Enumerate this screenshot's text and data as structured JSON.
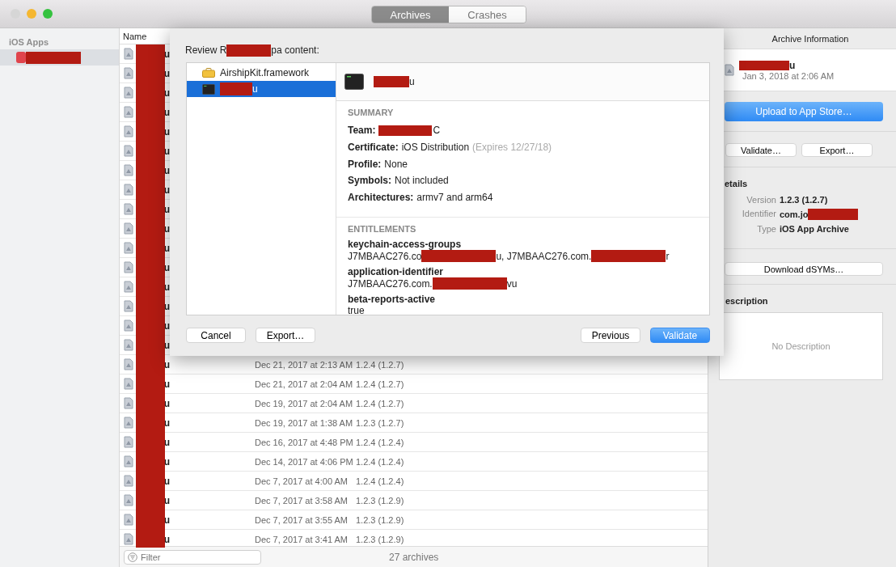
{
  "window": {
    "traffic_lights": [
      {
        "color": "#d6d6d6"
      },
      {
        "color": "#f5b731"
      },
      {
        "color": "#35c23f"
      }
    ],
    "segments": [
      {
        "label": "Archives",
        "selected": true
      },
      {
        "label": "Crashes",
        "selected": false
      }
    ]
  },
  "sidebar": {
    "header": "iOS Apps",
    "items": [
      {
        "selected": true,
        "parts": [
          {
            "kind": "redaction"
          }
        ]
      }
    ]
  },
  "table": {
    "columns": [
      "Name"
    ],
    "name_redacted": true,
    "rows": [
      {
        "name": "u"
      },
      {
        "name": "u"
      },
      {
        "name": "u"
      },
      {
        "name": "u"
      },
      {
        "name": "u"
      },
      {
        "name": "u"
      },
      {
        "name": "u"
      },
      {
        "name": "u"
      },
      {
        "name": "u"
      },
      {
        "name": "u"
      },
      {
        "name": "u"
      },
      {
        "name": "u"
      },
      {
        "name": "u"
      },
      {
        "name": "u"
      },
      {
        "name": "u"
      },
      {
        "name": "u"
      },
      {
        "name": "u",
        "date": "Dec 21, 2017 at 2:13 AM",
        "version": "1.2.4 (1.2.7)"
      },
      {
        "name": "u",
        "date": "Dec 21, 2017 at 2:04 AM",
        "version": "1.2.4 (1.2.7)"
      },
      {
        "name": "u",
        "date": "Dec 19, 2017 at 2:04 AM",
        "version": "1.2.4 (1.2.7)"
      },
      {
        "name": "u",
        "date": "Dec 19, 2017 at 1:38 AM",
        "version": "1.2.3 (1.2.7)"
      },
      {
        "name": "u",
        "date": "Dec 16, 2017 at 4:48 PM",
        "version": "1.2.4 (1.2.4)"
      },
      {
        "name": "u",
        "date": "Dec 14, 2017 at 4:06 PM",
        "version": "1.2.4 (1.2.4)"
      },
      {
        "name": "u",
        "date": "Dec 7, 2017 at 4:00 AM",
        "version": "1.2.4 (1.2.4)"
      },
      {
        "name": "u",
        "date": "Dec 7, 2017 at 3:58 AM",
        "version": "1.2.3 (1.2.9)"
      },
      {
        "name": "u",
        "date": "Dec 7, 2017 at 3:55 AM",
        "version": "1.2.3 (1.2.9)"
      },
      {
        "name": "u",
        "date": "Dec 7, 2017 at 3:41 AM",
        "version": "1.2.3 (1.2.9)"
      }
    ],
    "filter": {
      "placeholder": "Filter"
    },
    "count": "27 archives"
  },
  "sheet": {
    "title_parts": [
      {
        "kind": "text",
        "text": "Review R"
      },
      {
        "kind": "redaction"
      },
      {
        "kind": "text",
        "text": "pa content:"
      }
    ],
    "items": [
      {
        "kind": "framework",
        "selected": false,
        "parts": [
          {
            "kind": "text",
            "text": "AirshipKit.framework"
          }
        ]
      },
      {
        "kind": "app",
        "selected": true,
        "parts": [
          {
            "kind": "redaction"
          },
          {
            "kind": "text",
            "text": "u"
          }
        ]
      }
    ],
    "detail": {
      "parts": [
        {
          "kind": "redaction"
        },
        {
          "kind": "text",
          "text": "u"
        }
      ],
      "sections": [
        {
          "heading": "SUMMARY",
          "kind": "inline",
          "fields": [
            {
              "label": "Team:",
              "parts": [
                {
                  "kind": "redaction"
                },
                {
                  "kind": "text",
                  "text": "C"
                }
              ]
            },
            {
              "label": "Certificate:",
              "parts": [
                {
                  "kind": "text",
                  "text": "iOS Distribution"
                }
              ],
              "note": "(Expires 12/27/18)"
            },
            {
              "label": "Profile:",
              "parts": [
                {
                  "kind": "text",
                  "text": "None"
                }
              ]
            },
            {
              "label": "Symbols:",
              "parts": [
                {
                  "kind": "text",
                  "text": "Not included"
                }
              ]
            },
            {
              "label": "Architectures:",
              "parts": [
                {
                  "kind": "text",
                  "text": "armv7 and arm64"
                }
              ]
            }
          ]
        },
        {
          "heading": "ENTITLEMENTS",
          "kind": "stacked",
          "fields": [
            {
              "label": "keychain-access-groups",
              "parts": [
                {
                  "kind": "text",
                  "text": "J7MBAAC276.co"
                },
                {
                  "kind": "redaction"
                },
                {
                  "kind": "text",
                  "text": "u, J7MBAAC276.com."
                },
                {
                  "kind": "redaction"
                },
                {
                  "kind": "text",
                  "text": "r"
                }
              ]
            },
            {
              "label": "application-identifier",
              "parts": [
                {
                  "kind": "text",
                  "text": "J7MBAAC276.com."
                },
                {
                  "kind": "redaction"
                },
                {
                  "kind": "text",
                  "text": "vu"
                }
              ]
            },
            {
              "label": "beta-reports-active",
              "parts": [
                {
                  "kind": "text",
                  "text": "true"
                }
              ]
            }
          ]
        }
      ]
    },
    "left_buttons": [
      {
        "label": "Cancel",
        "primary": false
      },
      {
        "label": "Export…",
        "primary": false
      }
    ],
    "right_buttons": [
      {
        "label": "Previous",
        "primary": false
      },
      {
        "label": "Validate",
        "primary": true
      }
    ]
  },
  "inspector": {
    "title": "Archive Information",
    "archive": {
      "name_parts": [
        {
          "kind": "redaction"
        },
        {
          "kind": "text",
          "text": "u"
        }
      ],
      "date": "Jan 3, 2018 at 2:06 AM"
    },
    "upload_button": "Upload to App Store…",
    "buttons": [
      "Validate…",
      "Export…"
    ],
    "details_heading": "etails",
    "details": [
      {
        "label": "Version",
        "parts": [
          {
            "kind": "text",
            "text": "1.2.3 (1.2.7)"
          }
        ]
      },
      {
        "label": "Identifier",
        "parts": [
          {
            "kind": "text",
            "text": "com.jo"
          },
          {
            "kind": "redaction"
          }
        ]
      },
      {
        "label": "Type",
        "parts": [
          {
            "kind": "text",
            "text": "iOS App Archive"
          }
        ]
      }
    ],
    "dsyms_button": "Download dSYMs…",
    "description_heading": "escription",
    "description_placeholder": "No Description"
  }
}
